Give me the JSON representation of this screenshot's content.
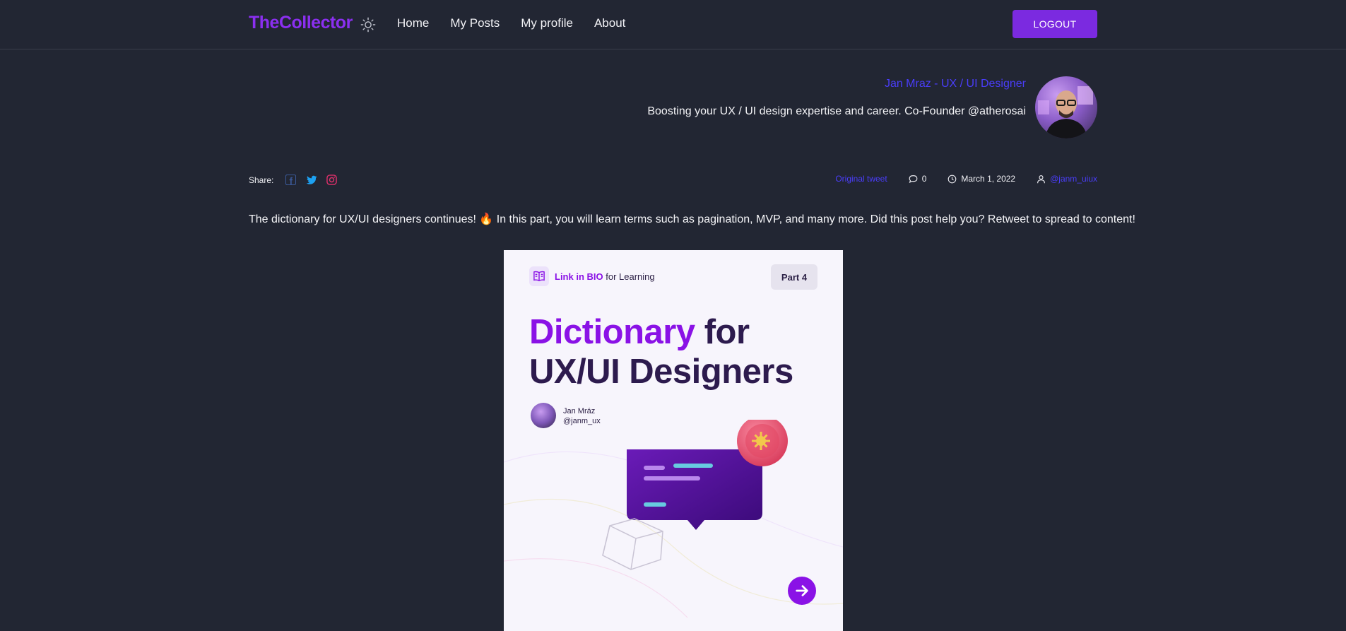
{
  "header": {
    "logo": "TheCollector",
    "theme_icon": "sun-icon",
    "nav": [
      {
        "label": "Home"
      },
      {
        "label": "My Posts"
      },
      {
        "label": "My profile"
      },
      {
        "label": "About"
      }
    ],
    "logout_label": "LOGOUT"
  },
  "author": {
    "name": "Jan Mraz - UX / UI Designer",
    "bio": "Boosting your UX / UI design expertise and career. Co-Founder @atherosai"
  },
  "share": {
    "label": "Share:",
    "icons": [
      "facebook-icon",
      "twitter-icon",
      "instagram-icon"
    ]
  },
  "meta": {
    "original_tweet": "Original tweet",
    "comments": "0",
    "date": "March 1, 2022",
    "handle": "@janm_uiux"
  },
  "post": {
    "text": "The dictionary for UX/UI designers continues! 🔥 In this part, you will learn terms such as pagination, MVP, and many more. Did this post help you? Retweet to spread to content!"
  },
  "card": {
    "badge_highlight": "Link in BIO",
    "badge_rest": " for Learning",
    "part": "Part 4",
    "title_accent": "Dictionary",
    "title_rest_1": " for",
    "title_line_2": "UX/UI Designers",
    "author_name": "Jan Mráz",
    "author_handle": "@janm_ux"
  },
  "colors": {
    "background": "#222633",
    "brand": "#8b2ff0",
    "button": "#7b2ae0",
    "link": "#4a3dfa",
    "facebook": "#3b5998",
    "twitter": "#1da1f2",
    "instagram": "#e1306c"
  }
}
